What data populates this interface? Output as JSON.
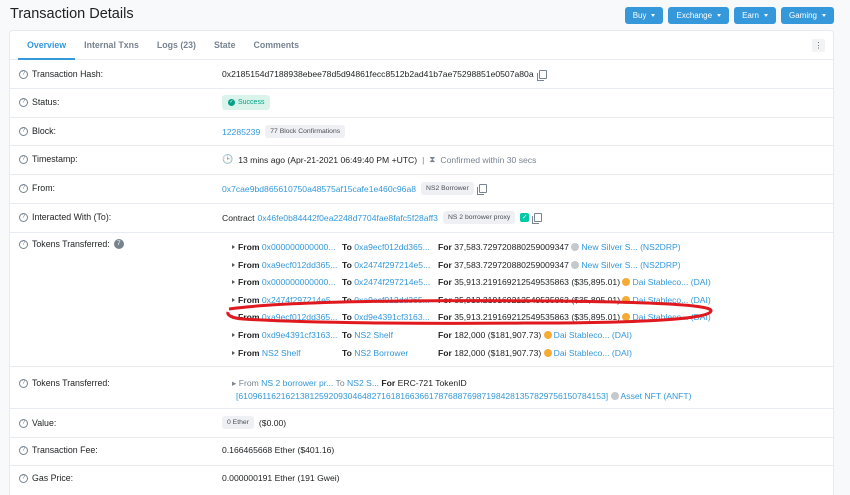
{
  "page": {
    "title": "Transaction Details"
  },
  "topbar": {
    "buttons": [
      "Buy",
      "Exchange",
      "Earn",
      "Gaming"
    ]
  },
  "tabs": [
    "Overview",
    "Internal Txns",
    "Logs (23)",
    "State",
    "Comments"
  ],
  "fields": {
    "hash": {
      "label": "Transaction Hash:",
      "value": "0x2185154d7188938ebee78d5d94861fecc8512b2ad41b7ae75298851e0507a80a"
    },
    "status": {
      "label": "Status:",
      "value": "Success"
    },
    "block": {
      "label": "Block:",
      "value": "12285239",
      "confirmations": "77 Block Confirmations"
    },
    "timestamp": {
      "label": "Timestamp:",
      "value": "13 mins ago (Apr-21-2021 06:49:40 PM +UTC)",
      "divider": "|",
      "confirmed": "Confirmed within 30 secs"
    },
    "from": {
      "label": "From:",
      "address": "0x7cae9bd865610750a48575af15cafe1e460c96a8",
      "tag": "NS2 Borrower"
    },
    "to": {
      "label": "Interacted With (To):",
      "prefix": "Contract",
      "address": "0x46fe0b84442f0ea2248d7704fae8fafc5f28aff3",
      "tag": "NS 2 borrower proxy"
    },
    "tokens": {
      "label": "Tokens Transferred:",
      "count": "7"
    },
    "tokens_nft": {
      "label": "Tokens Transferred:",
      "from_word": "From",
      "from": "NS 2 borrower pr...",
      "to_word": "To",
      "to": "NS2 S...",
      "for_word": "For",
      "for_value": "ERC-721 TokenID",
      "token_id": "[61096116216213812592093046482716181663661787688769871984281357829756150784153]",
      "token_name": "Asset NFT (ANFT)"
    },
    "value": {
      "label": "Value:",
      "badge": "0 Ether",
      "usd": "($0.00)"
    },
    "fee": {
      "label": "Transaction Fee:",
      "value": "0.166465668 Ether ($401.16)"
    },
    "gas": {
      "label": "Gas Price:",
      "value": "0.000000191 Ether (191 Gwei)"
    }
  },
  "transfers_words": {
    "from": "From",
    "to": "To",
    "for": "For"
  },
  "transfers": [
    {
      "from": "0x000000000000...",
      "to": "0xa9ecf012dd365...",
      "amount": "37,583.729720880259009347",
      "usd": "",
      "token": "New Silver S... (NS2DRP)",
      "token_color": "grey"
    },
    {
      "from": "0xa9ecf012dd365...",
      "to": "0x2474f297214e5...",
      "amount": "37,583.729720880259009347",
      "usd": "",
      "token": "New Silver S... (NS2DRP)",
      "token_color": "grey"
    },
    {
      "from": "0x000000000000...",
      "to": "0x2474f297214e5...",
      "amount": "35,913.219169212549535863",
      "usd": "($35,895.01)",
      "token": "Dai Stableco... (DAI)",
      "token_color": "dai"
    },
    {
      "from": "0x2474f297214e5...",
      "to": "0xa9ecf012dd365...",
      "amount": "35,913.219169212549535863",
      "usd": "($35,895.01)",
      "token": "Dai Stableco... (DAI)",
      "token_color": "dai"
    },
    {
      "from": "0xa9ecf012dd365...",
      "to": "0xd9e4391cf3163...",
      "amount": "35,913.219169212549535863",
      "usd": "($35,895.01)",
      "token": "Dai Stableco... (DAI)",
      "token_color": "dai"
    },
    {
      "from": "0xd9e4391cf3163...",
      "to": "NS2 Shelf",
      "amount": "182,000",
      "usd": "($181,907.73)",
      "token": "Dai Stableco... (DAI)",
      "token_color": "dai"
    },
    {
      "from": "NS2 Shelf",
      "to": "NS2 Borrower",
      "amount": "182,000",
      "usd": "($181,907.73)",
      "token": "Dai Stableco... (DAI)",
      "token_color": "dai"
    }
  ],
  "colors": {
    "accent": "#3498db",
    "success": "#00a186",
    "annotation": "#e0191e"
  }
}
